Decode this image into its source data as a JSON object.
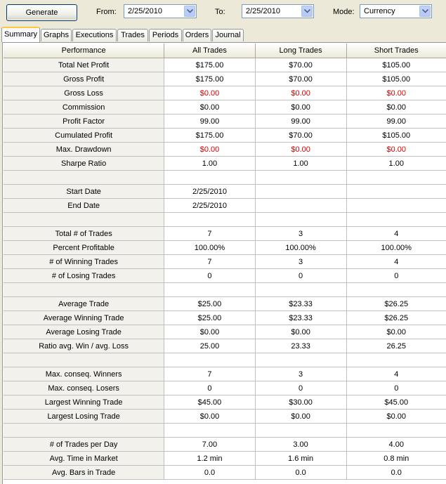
{
  "toolbar": {
    "generate_label": "Generate",
    "from_label": "From:",
    "from_value": "2/25/2010",
    "to_label": "To:",
    "to_value": "2/25/2010",
    "mode_label": "Mode:",
    "mode_value": "Currency"
  },
  "tabs": [
    {
      "label": "Summary"
    },
    {
      "label": "Graphs"
    },
    {
      "label": "Executions"
    },
    {
      "label": "Trades"
    },
    {
      "label": "Periods"
    },
    {
      "label": "Orders"
    },
    {
      "label": "Journal"
    }
  ],
  "active_tab": "Summary",
  "colors": {
    "negative": "#d40000",
    "tab_highlight": "#ffc83c",
    "row_label_bg": "#f2f1ec"
  },
  "grid": {
    "headers": [
      "Performance",
      "All Trades",
      "Long Trades",
      "Short Trades"
    ],
    "rows": [
      {
        "label": "Total Net Profit",
        "all": "$175.00",
        "long": "$70.00",
        "short": "$105.00"
      },
      {
        "label": "Gross Profit",
        "all": "$175.00",
        "long": "$70.00",
        "short": "$105.00"
      },
      {
        "label": "Gross Loss",
        "all": "$0.00",
        "long": "$0.00",
        "short": "$0.00",
        "negative": true
      },
      {
        "label": "Commission",
        "all": "$0.00",
        "long": "$0.00",
        "short": "$0.00"
      },
      {
        "label": "Profit Factor",
        "all": "99.00",
        "long": "99.00",
        "short": "99.00"
      },
      {
        "label": "Cumulated Profit",
        "all": "$175.00",
        "long": "$70.00",
        "short": "$105.00"
      },
      {
        "label": "Max. Drawdown",
        "all": "$0.00",
        "long": "$0.00",
        "short": "$0.00",
        "negative": true
      },
      {
        "label": "Sharpe Ratio",
        "all": "1.00",
        "long": "1.00",
        "short": "1.00"
      },
      {
        "label": "",
        "all": "",
        "long": "",
        "short": ""
      },
      {
        "label": "Start Date",
        "all": "2/25/2010",
        "long": "",
        "short": ""
      },
      {
        "label": "End Date",
        "all": "2/25/2010",
        "long": "",
        "short": ""
      },
      {
        "label": "",
        "all": "",
        "long": "",
        "short": ""
      },
      {
        "label": "Total # of Trades",
        "all": "7",
        "long": "3",
        "short": "4"
      },
      {
        "label": "Percent Profitable",
        "all": "100.00%",
        "long": "100.00%",
        "short": "100.00%"
      },
      {
        "label": "# of Winning Trades",
        "all": "7",
        "long": "3",
        "short": "4"
      },
      {
        "label": "# of Losing Trades",
        "all": "0",
        "long": "0",
        "short": "0"
      },
      {
        "label": "",
        "all": "",
        "long": "",
        "short": ""
      },
      {
        "label": "Average Trade",
        "all": "$25.00",
        "long": "$23.33",
        "short": "$26.25"
      },
      {
        "label": "Average Winning Trade",
        "all": "$25.00",
        "long": "$23.33",
        "short": "$26.25"
      },
      {
        "label": "Average Losing Trade",
        "all": "$0.00",
        "long": "$0.00",
        "short": "$0.00"
      },
      {
        "label": "Ratio avg. Win / avg. Loss",
        "all": "25.00",
        "long": "23.33",
        "short": "26.25"
      },
      {
        "label": "",
        "all": "",
        "long": "",
        "short": ""
      },
      {
        "label": "Max. conseq. Winners",
        "all": "7",
        "long": "3",
        "short": "4"
      },
      {
        "label": "Max. conseq. Losers",
        "all": "0",
        "long": "0",
        "short": "0"
      },
      {
        "label": "Largest Winning Trade",
        "all": "$45.00",
        "long": "$30.00",
        "short": "$45.00"
      },
      {
        "label": "Largest Losing Trade",
        "all": "$0.00",
        "long": "$0.00",
        "short": "$0.00"
      },
      {
        "label": "",
        "all": "",
        "long": "",
        "short": ""
      },
      {
        "label": "# of Trades per Day",
        "all": "7.00",
        "long": "3.00",
        "short": "4.00"
      },
      {
        "label": "Avg. Time in Market",
        "all": "1.2 min",
        "long": "1.6 min",
        "short": "0.8 min"
      },
      {
        "label": "Avg. Bars in Trade",
        "all": "0.0",
        "long": "0.0",
        "short": "0.0"
      }
    ]
  }
}
